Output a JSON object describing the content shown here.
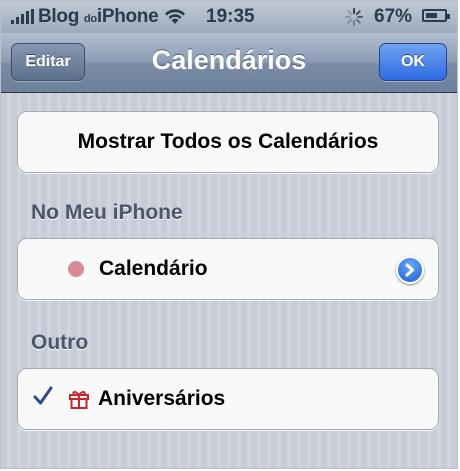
{
  "status_bar": {
    "carrier_main": "Blog",
    "carrier_small": "do",
    "carrier_end": "iPhone",
    "time": "19:35",
    "battery_text": "67%",
    "battery_level": 0.67
  },
  "nav": {
    "title": "Calendários",
    "edit_label": "Editar",
    "ok_label": "OK"
  },
  "show_all": {
    "label": "Mostrar Todos os Calendários"
  },
  "sections": {
    "on_phone": {
      "header": "No Meu iPhone",
      "calendar_label": "Calendário",
      "calendar_color": "#d98a99"
    },
    "other": {
      "header": "Outro",
      "item_label": "Aniversários",
      "checked": true
    }
  },
  "colors": {
    "accent": "#2f6be0",
    "checkmark": "#2d4d8a",
    "gift": "#c8262b"
  }
}
